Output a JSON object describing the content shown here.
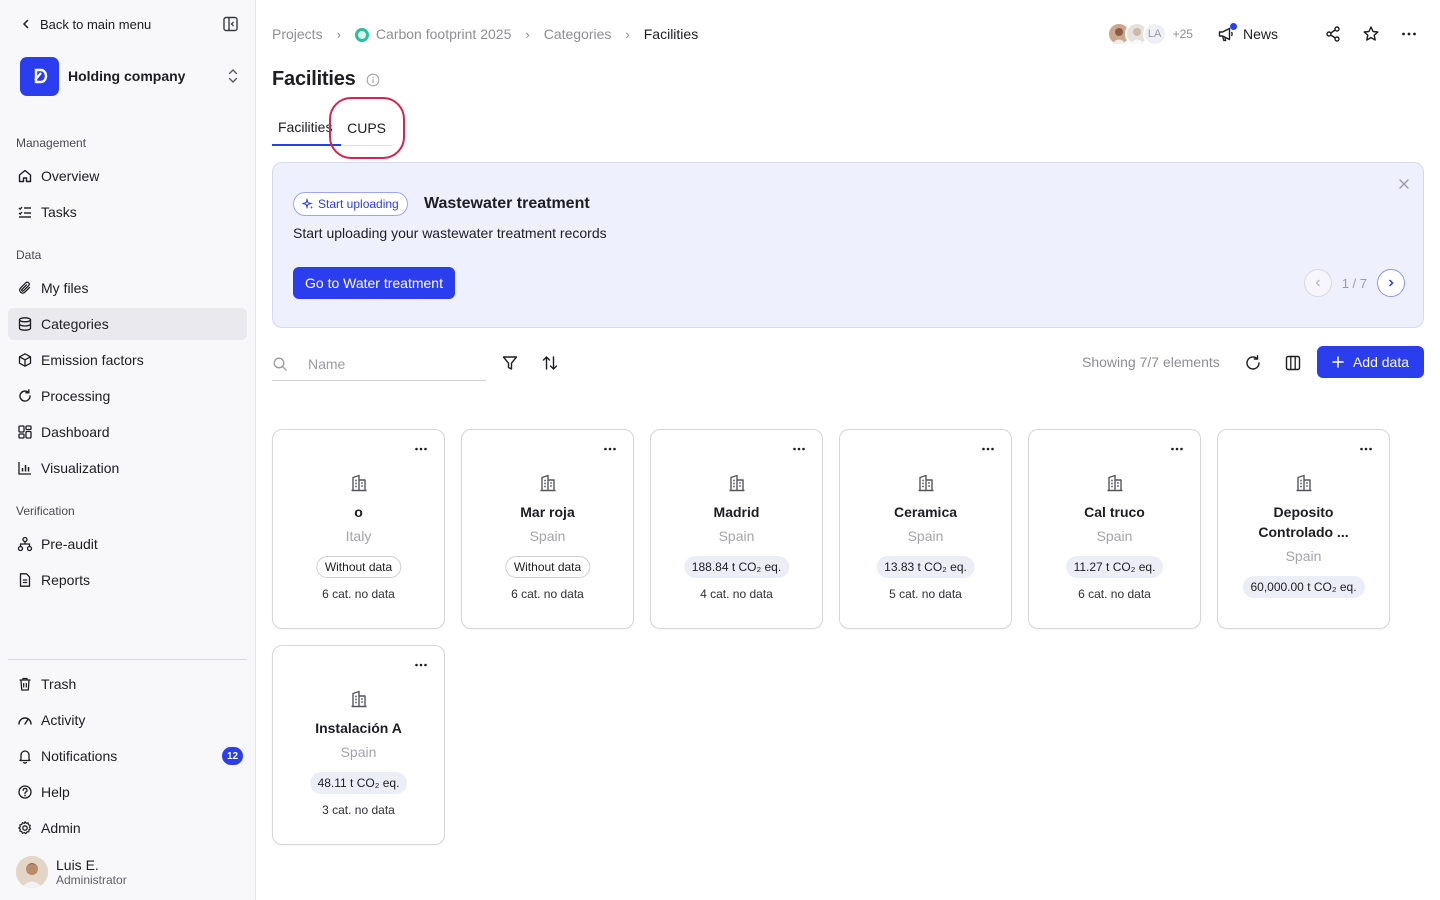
{
  "sidebar": {
    "back_label": "Back to main menu",
    "org_name": "Holding company",
    "sections": {
      "management": "Management",
      "data": "Data",
      "verification": "Verification"
    },
    "items": {
      "overview": "Overview",
      "tasks": "Tasks",
      "my_files": "My files",
      "categories": "Categories",
      "emission_factors": "Emission factors",
      "processing": "Processing",
      "dashboard": "Dashboard",
      "visualization": "Visualization",
      "pre_audit": "Pre-audit",
      "reports": "Reports",
      "trash": "Trash",
      "activity": "Activity",
      "notifications": "Notifications",
      "help": "Help",
      "admin": "Admin"
    },
    "notifications_count": "12",
    "user": {
      "name": "Luis E.",
      "role": "Administrator"
    }
  },
  "header": {
    "breadcrumb": [
      "Projects",
      "Carbon footprint 2025",
      "Categories",
      "Facilities"
    ],
    "avatar_initials": "LA",
    "avatar_more": "+25",
    "news_label": "News"
  },
  "page": {
    "title": "Facilities",
    "tabs": [
      "Facilities",
      "CUPS"
    ],
    "active_tab": "Facilities"
  },
  "banner": {
    "pill_label": "Start uploading",
    "title": "Wastewater treatment",
    "text": "Start uploading your wastewater treatment records",
    "cta_label": "Go to Water treatment",
    "pager": "1 / 7"
  },
  "toolbar": {
    "search_placeholder": "Name",
    "showing": "Showing 7/7 elements",
    "add_label": "Add data"
  },
  "cards": [
    {
      "name": "o",
      "country": "Italy",
      "chip": "Without data",
      "chip_type": "nodata",
      "cats": "6 cat. no data"
    },
    {
      "name": "Mar roja",
      "country": "Spain",
      "chip": "Without data",
      "chip_type": "nodata",
      "cats": "6 cat. no data"
    },
    {
      "name": "Madrid",
      "country": "Spain",
      "chip": "188.84 t CO₂ eq.",
      "chip_type": "val",
      "cats": "4 cat. no data"
    },
    {
      "name": "Ceramica",
      "country": "Spain",
      "chip": "13.83 t CO₂ eq.",
      "chip_type": "val",
      "cats": "5 cat. no data"
    },
    {
      "name": "Cal truco",
      "country": "Spain",
      "chip": "11.27 t CO₂ eq.",
      "chip_type": "val",
      "cats": "6 cat. no data"
    },
    {
      "name": "Deposito Controlado ...",
      "country": "Spain",
      "chip": "60,000.00 t CO₂ eq.",
      "chip_type": "val",
      "cats": ""
    },
    {
      "name": "Instalación A",
      "country": "Spain",
      "chip": "48.11 t CO₂ eq.",
      "chip_type": "val",
      "cats": "3 cat. no data"
    }
  ],
  "colors": {
    "accent": "#2a3ef0",
    "highlight": "#d4254f",
    "project_dot": "#2bbfa0"
  }
}
